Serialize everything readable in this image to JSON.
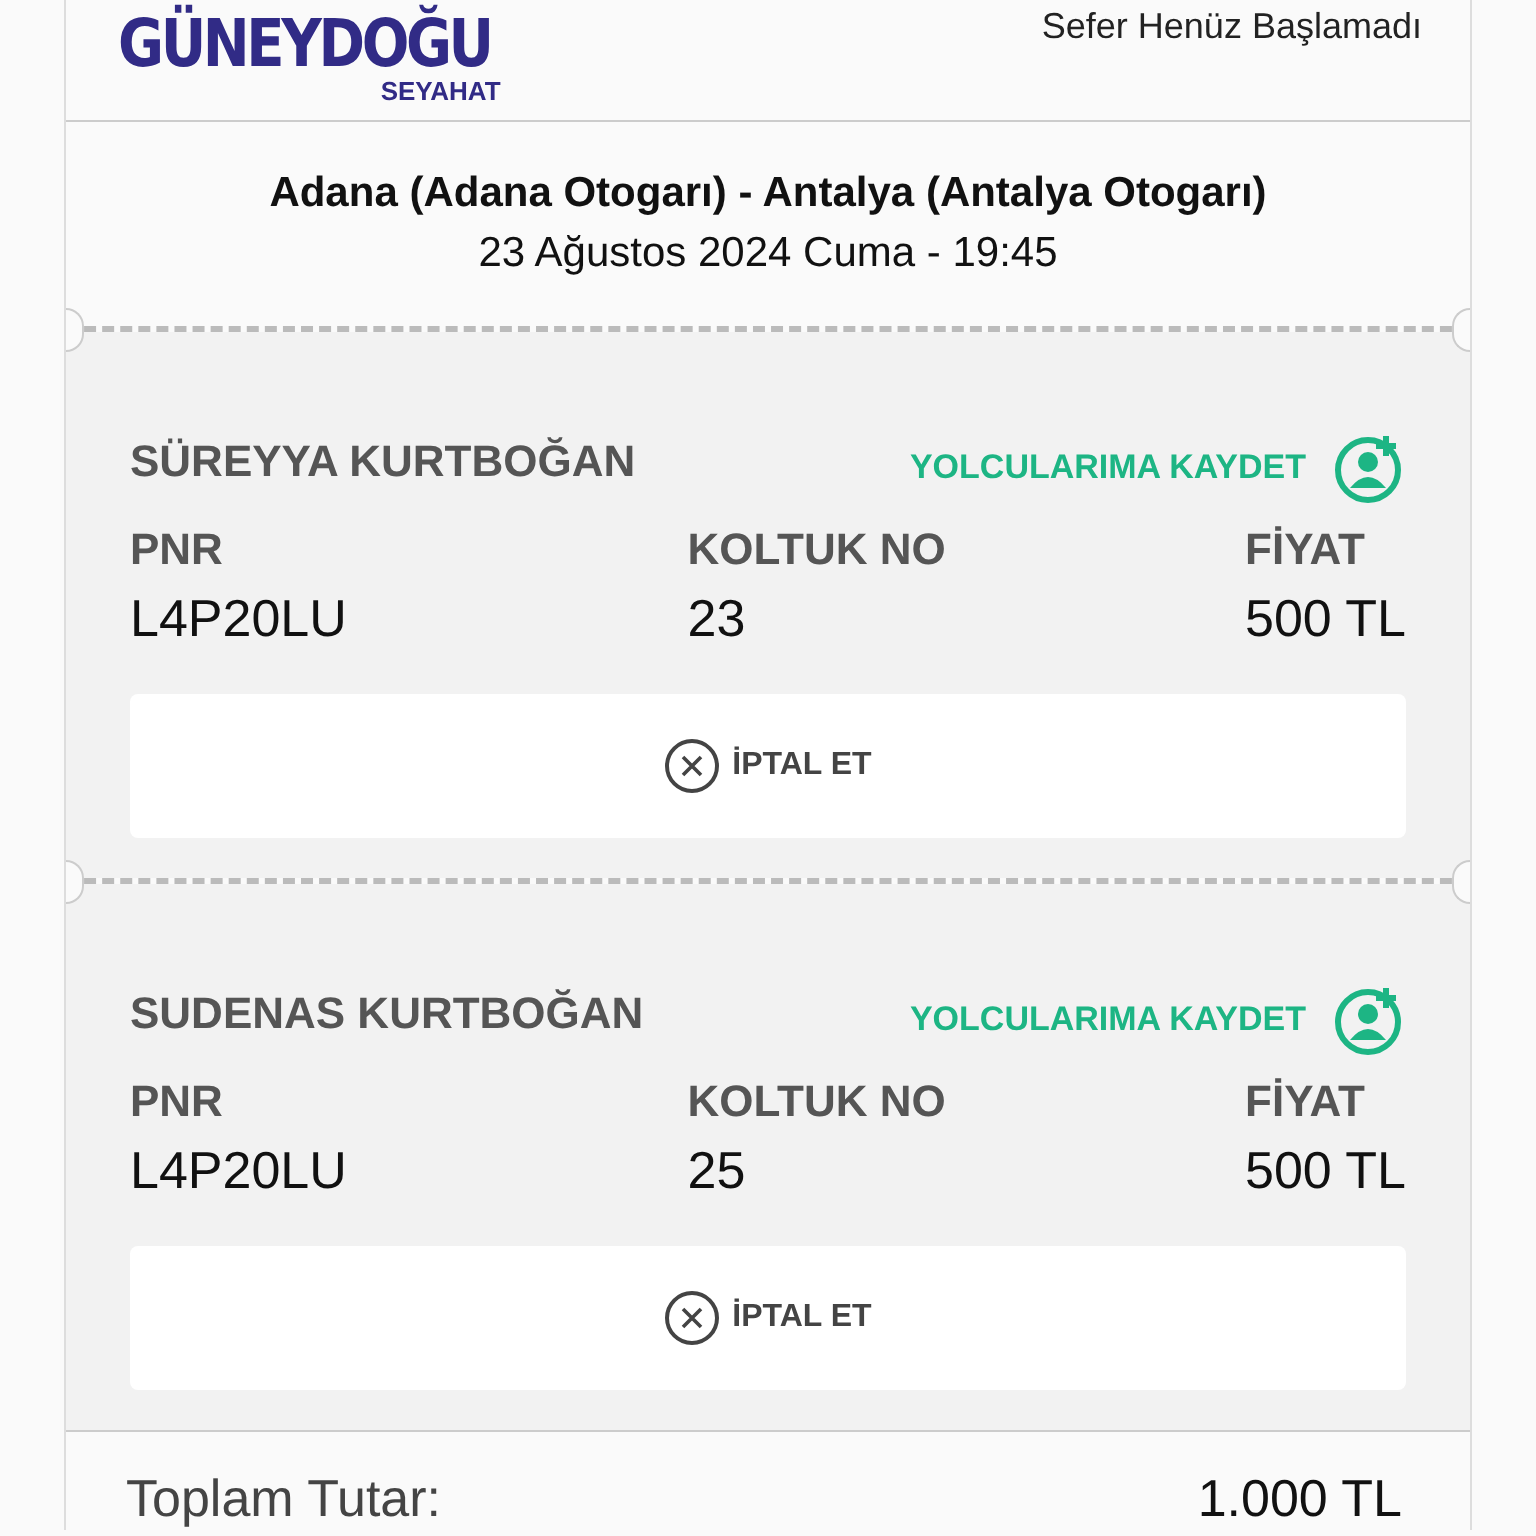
{
  "header": {
    "logo": {
      "name": "GÜNEYDOĞU",
      "tagline": "SEYAHAT"
    },
    "status": "Sefer Henüz Başlamadı"
  },
  "trip": {
    "route": "Adana (Adana Otogarı) - Antalya (Antalya Otogarı)",
    "datetime": "23 Ağustos 2024 Cuma - 19:45"
  },
  "passengers": [
    {
      "name": "SÜREYYA KURTBOĞAN",
      "save_label": "YOLCULARIMA KAYDET",
      "fields": [
        {
          "label": "PNR",
          "value": "L4P20LU"
        },
        {
          "label": "KOLTUK NO",
          "value": "23"
        },
        {
          "label": "FİYAT",
          "value": "500 TL"
        }
      ],
      "cancel_label": "İPTAL ET"
    },
    {
      "name": "SUDENAS KURTBOĞAN",
      "save_label": "YOLCULARIMA KAYDET",
      "fields": [
        {
          "label": "PNR",
          "value": "L4P20LU"
        },
        {
          "label": "KOLTUK NO",
          "value": "25"
        },
        {
          "label": "FİYAT",
          "value": "500 TL"
        }
      ],
      "cancel_label": "İPTAL ET"
    }
  ],
  "total": {
    "label": "Toplam Tutar:",
    "value": "1.000 TL"
  }
}
